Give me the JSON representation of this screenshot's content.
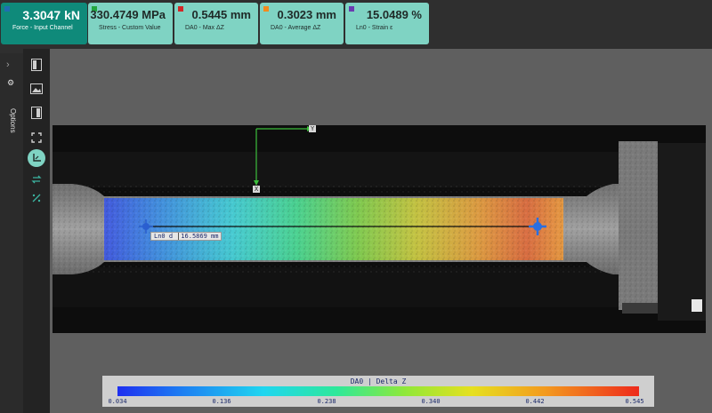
{
  "cards": [
    {
      "value": "3.3047 kN",
      "label": "Force -  Input Channel",
      "color": "#1f6fb0",
      "primary": true
    },
    {
      "value": "330.4749 MPa",
      "label": "Stress -  Custom Value",
      "color": "#22a640"
    },
    {
      "value": "0.5445 mm",
      "label": "DA0 -  Max ΔZ",
      "color": "#d22626"
    },
    {
      "value": "0.3023 mm",
      "label": "DA0 -  Average ΔZ",
      "color": "#f28a1c"
    },
    {
      "value": "15.0489 %",
      "label": "Ln0 -  Strain ε",
      "color": "#6a3bb0"
    }
  ],
  "rail": {
    "label": "Options"
  },
  "tools": [
    "panel-left-icon",
    "image-icon",
    "panel-right-icon",
    "fit-screen-icon",
    "axes-icon",
    "swap-icon",
    "measure-icon"
  ],
  "overlay": {
    "axis_y": "Y",
    "axis_x": "X",
    "gauge_label": "Ln0 d",
    "gauge_value": "16.5869",
    "gauge_unit": "mm"
  },
  "legend": {
    "title": "DA0 |  Delta Z",
    "ticks": [
      "0.034",
      "0.136",
      "0.238",
      "0.340",
      "0.442",
      "0.545"
    ]
  }
}
